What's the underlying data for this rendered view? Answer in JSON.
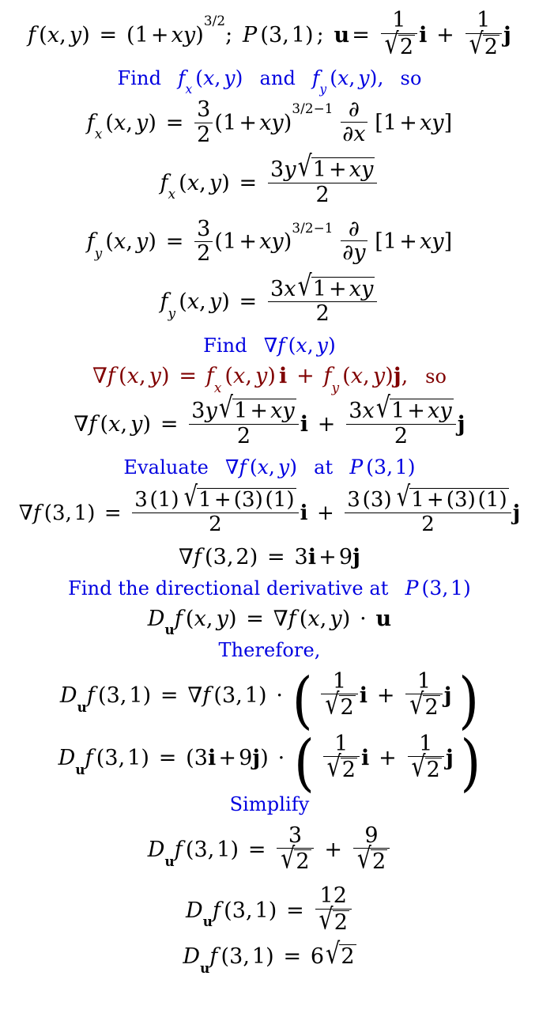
{
  "document": {
    "kind": "math-worked-solution",
    "topic": "Directional derivative of f(x,y) = (1+xy)^(3/2) at P(3,1) in direction u",
    "colors": {
      "body_text": "#000000",
      "instruction_text": "#0000e0",
      "highlight_formula": "#800000",
      "background": "#ffffff"
    }
  },
  "lines": [
    {
      "id": "given",
      "role": "equation",
      "color": "#000000",
      "text": "f (x, y) = (1 + xy)^{3/2}; P (3, 1) ; u = 1/√2 i + 1/√2 j"
    },
    {
      "id": "find-partials",
      "role": "instruction",
      "color": "#0000e0",
      "text": "Find  f_x (x, y)  and  f_y (x, y) ,  so"
    },
    {
      "id": "fx-chain",
      "role": "equation",
      "color": "#000000",
      "text": "f_x (x, y) = 3/2 (1 + xy)^{3/2-1} ∂/∂x [1 + xy]"
    },
    {
      "id": "fx-result",
      "role": "equation",
      "color": "#000000",
      "text": "f_x (x, y) = 3y√(1 + xy) / 2"
    },
    {
      "id": "fy-chain",
      "role": "equation",
      "color": "#000000",
      "text": "f_y (x, y) = 3/2 (1 + xy)^{3/2-1} ∂/∂y [1 + xy]"
    },
    {
      "id": "fy-result",
      "role": "equation",
      "color": "#000000",
      "text": "f_y (x, y) = 3x√(1 + xy) / 2"
    },
    {
      "id": "find-gradient",
      "role": "instruction",
      "color": "#0000e0",
      "text": "Find ∇f (x, y)"
    },
    {
      "id": "gradient-definition",
      "role": "highlight",
      "color": "#800000",
      "text": "∇f (x, y) = f_x (x, y) i + f_y (x, y) j,  so"
    },
    {
      "id": "gradient-expanded",
      "role": "equation",
      "color": "#000000",
      "text": "∇f (x, y) = 3y√(1 + xy)/2 i + 3x√(1 + xy)/2 j"
    },
    {
      "id": "evaluate-gradient",
      "role": "instruction",
      "color": "#0000e0",
      "text": "Evaluate ∇f (x, y)  at  P (3, 1)"
    },
    {
      "id": "gradient-substituted",
      "role": "equation",
      "color": "#000000",
      "text": "∇f (3, 1) = 3 (1) √(1 + (3)(1)) / 2 i + 3 (3) √(1 + (3)(1)) / 2 j"
    },
    {
      "id": "gradient-value",
      "role": "equation",
      "color": "#000000",
      "text": "∇f (3, 2) = 3i + 9j"
    },
    {
      "id": "find-directional",
      "role": "instruction",
      "color": "#0000e0",
      "text": "Find the directional derivative at P (3, 1)"
    },
    {
      "id": "directional-definition",
      "role": "equation",
      "color": "#000000",
      "text": "D_u f (x, y) = ∇f (x, y) · u"
    },
    {
      "id": "therefore",
      "role": "instruction",
      "color": "#0000e0",
      "text": "Therefore,"
    },
    {
      "id": "directional-sub1",
      "role": "equation",
      "color": "#000000",
      "text": "D_u f (3, 1) = ∇f (3, 1) · ( 1/√2 i + 1/√2 j )"
    },
    {
      "id": "directional-sub2",
      "role": "equation",
      "color": "#000000",
      "text": "D_u f (3, 1) = (3i + 9j) · ( 1/√2 i + 1/√2 j )"
    },
    {
      "id": "simplify",
      "role": "instruction",
      "color": "#0000e0",
      "text": "Simplify"
    },
    {
      "id": "simplify-1",
      "role": "equation",
      "color": "#000000",
      "text": "D_u f (3, 1) = 3/√2 + 9/√2"
    },
    {
      "id": "simplify-2",
      "role": "equation",
      "color": "#000000",
      "text": "D_u f (3, 1) = 12/√2"
    },
    {
      "id": "final-answer",
      "role": "equation",
      "color": "#000000",
      "text": "D_u f (3, 1) = 6√2"
    }
  ],
  "symbols": {
    "f": "f",
    "x": "x",
    "y": "y",
    "u": "u",
    "i": "i",
    "j": "j",
    "D": "D",
    "P": "P",
    "nabla": "∇",
    "partial": "∂",
    "radical": "√",
    "dot": "·",
    "equals": "=",
    "plus": "+",
    "comma": ",",
    "semicolon": ";",
    "lparen": "(",
    "rparen": ")",
    "lbracket": "[",
    "rbracket": "]",
    "minus": "−"
  },
  "numbers": {
    "one": "1",
    "two": "2",
    "three": "3",
    "nine": "9",
    "twelve": "12",
    "six": "6",
    "exp_three": "3",
    "exp_slash": "/",
    "exp_two": "2",
    "exp_minus_one": "−1"
  },
  "words": {
    "find": "Find",
    "and": "and",
    "so": "so",
    "evaluate": "Evaluate",
    "at": "at",
    "find_the_directional_derivative_at": "Find the directional derivative at",
    "therefore": "Therefore,",
    "simplify": "Simplify"
  }
}
